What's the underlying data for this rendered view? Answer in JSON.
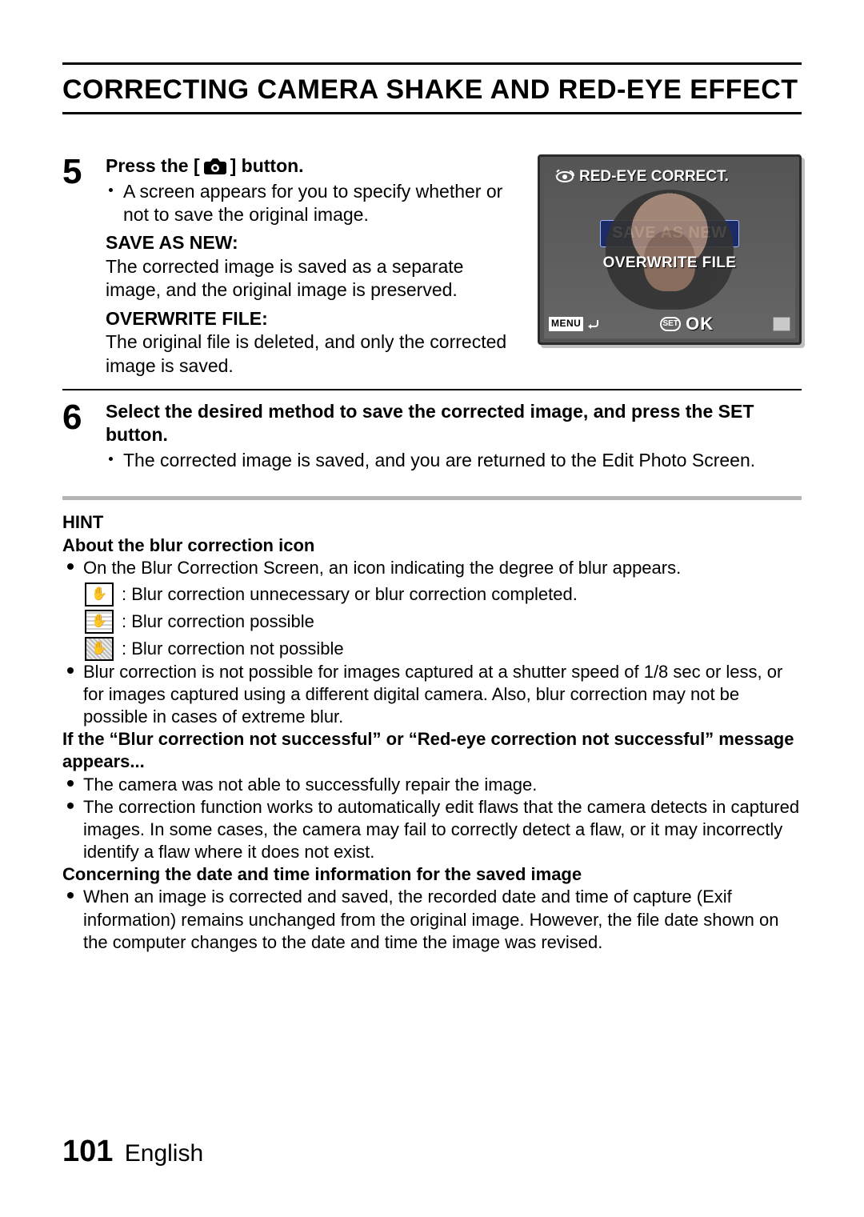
{
  "title": "CORRECTING CAMERA SHAKE AND RED-EYE EFFECT",
  "step5": {
    "num": "5",
    "head_pre": "Press the [",
    "head_post": "] button.",
    "bullet": "A screen appears for you to specify whether or not to save the original image.",
    "save_head": "SAVE AS NEW:",
    "save_body": "The corrected image is saved as a separate image, and the original image is preserved.",
    "over_head": "OVERWRITE FILE:",
    "over_body": "The original file is deleted, and only the corrected image is saved."
  },
  "lcd": {
    "top": "RED-EYE CORRECT.",
    "opt1": "SAVE AS NEW",
    "opt2": "OVERWRITE FILE",
    "menu": "MENU",
    "set": "SET",
    "ok": "OK"
  },
  "step6": {
    "num": "6",
    "head": "Select the desired method to save the corrected image, and press the SET button.",
    "bullet": "The corrected image is saved, and you are returned to the Edit Photo Screen."
  },
  "hint": {
    "title": "HINT",
    "sub1": "About the blur correction icon",
    "b1": "On the Blur Correction Screen, an icon indicating the degree of blur appears.",
    "ic1": ": Blur correction unnecessary or blur correction completed.",
    "ic2": ": Blur correction possible",
    "ic3": ": Blur correction not possible",
    "b2": "Blur correction is not possible for images captured at a shutter speed of 1/8 sec or less, or for images captured using a different digital camera. Also, blur correction may not be possible in cases of extreme blur.",
    "sub2": "If the “Blur correction not successful” or “Red-eye correction not successful” message appears...",
    "b3": "The camera was not able to successfully repair the image.",
    "b4": "The correction function works to automatically edit flaws that the camera detects in captured images. In some cases, the camera may fail to correctly detect a flaw, or it may incorrectly identify a flaw where it does not exist.",
    "sub3": "Concerning the date and time information for the saved image",
    "b5": "When an image is corrected and saved, the recorded date and time of capture (Exif information) remains unchanged from the original image. However, the file date shown on the computer changes to the date and time the image was revised."
  },
  "footer": {
    "page": "101",
    "lang": "English"
  }
}
